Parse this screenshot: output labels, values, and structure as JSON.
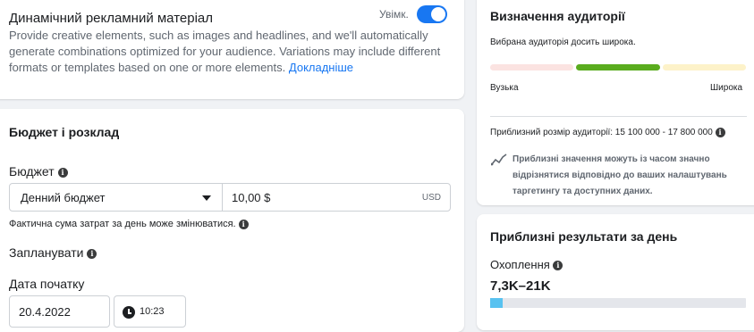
{
  "dynamic_creative": {
    "title": "Динамічний рекламний матеріал",
    "toggle_label": "Увімк.",
    "enabled": true,
    "description": "Provide creative elements, such as images and headlines, and we'll automatically generate combinations optimized for your audience. Variations may include different formats or templates based on one or more elements.",
    "learn_more": "Докладніше"
  },
  "budget_schedule": {
    "title": "Бюджет і розклад",
    "budget_label": "Бюджет",
    "budget_type": "Денний бюджет",
    "budget_amount": "10,00 $",
    "currency": "USD",
    "note": "Фактична сума затрат за день може змінюватися.",
    "schedule_label": "Запланувати",
    "start_date_label": "Дата початку",
    "start_date": "20.4.2022",
    "start_time": "10:23"
  },
  "audience": {
    "title": "Визначення аудиторії",
    "status": "Вибрана аудиторія досить широка.",
    "left_label": "Вузька",
    "right_label": "Широка",
    "meter_colors": [
      "#fbe3e1",
      "#5aac1e",
      "#fdf2c9"
    ],
    "size_label": "Приблизний розмір аудиторії: 15 100 000 - 17 800 000",
    "trend_note": "Приблизні значення можуть із часом значно відрізнятися відповідно до ваших налаштувань таргетингу та доступних даних."
  },
  "results": {
    "title": "Приблизні результати за день",
    "reach_label": "Охоплення",
    "reach_value": "7,3K–21K",
    "reach_bar_fraction": 0.05
  },
  "colors": {
    "accent": "#1877f2",
    "reach_fill": "#58c2f0"
  }
}
